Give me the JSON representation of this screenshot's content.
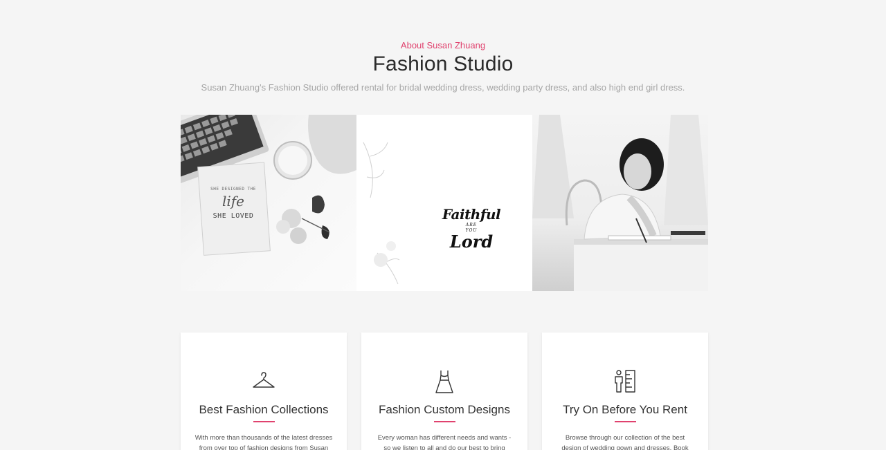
{
  "intro": {
    "eyebrow": "About Susan Zhuang",
    "title": "Fashion Studio",
    "subtitle": "Susan Zhuang's Fashion Studio offered rental for bridal wedding dress, wedding party dress, and also high end girl dress."
  },
  "banner": {
    "notebook": {
      "line1": "SHE DESIGNED THE",
      "line2": "life",
      "line3": "SHE LOVED"
    },
    "script": {
      "line1": "Faithful",
      "line2": "ARE",
      "line3": "YOU",
      "line4": "Lord"
    }
  },
  "cards": [
    {
      "icon": "hanger-icon",
      "title": "Best Fashion Collections",
      "text": "With more than thousands of the latest dresses from over top of fashion designs from Susan"
    },
    {
      "icon": "dress-icon",
      "title": "Fashion Custom Designs",
      "text": "Every woman has different needs and wants - so we listen to all and do our best to bring every"
    },
    {
      "icon": "fitting-measure-icon",
      "title": "Try On Before You Rent",
      "text": "Browse through our collection of the best design of wedding gown and dresses. Book your"
    }
  ],
  "colors": {
    "accent": "#e0426e",
    "background": "#f5f5f5"
  }
}
